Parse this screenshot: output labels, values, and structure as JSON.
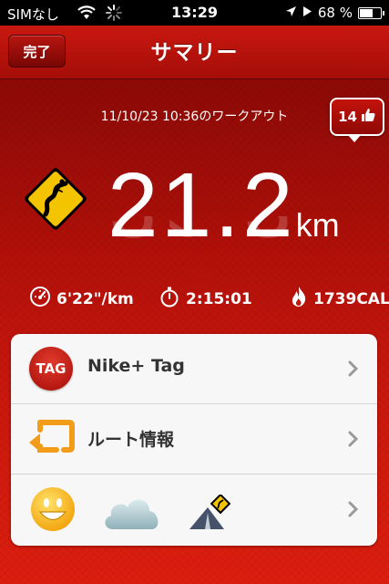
{
  "status": {
    "carrier": "SIMなし",
    "time": "13:29",
    "battery": "68 %",
    "battery_level": 0.68
  },
  "nav": {
    "done_label": "完了",
    "title": "サマリー"
  },
  "workout": {
    "datetime": "11/10/23 10:36のワークアウト",
    "likes": "14",
    "distance": "21.2",
    "unit": "km"
  },
  "stats": {
    "pace": "6'22\"/km",
    "duration": "2:15:01",
    "calories": "1739CAL"
  },
  "card": {
    "rows": [
      {
        "label": "Nike+ Tag",
        "icon": "tag-icon",
        "icon_text": "TAG"
      },
      {
        "label": "ルート情報",
        "icon": "route-icon"
      },
      {
        "label": "",
        "icon": "smiley-cloud-road-icons"
      }
    ]
  },
  "colors": {
    "accent": "#c4160f",
    "icon_orange": "#f39c1a",
    "sign_yellow": "#f5c400"
  }
}
